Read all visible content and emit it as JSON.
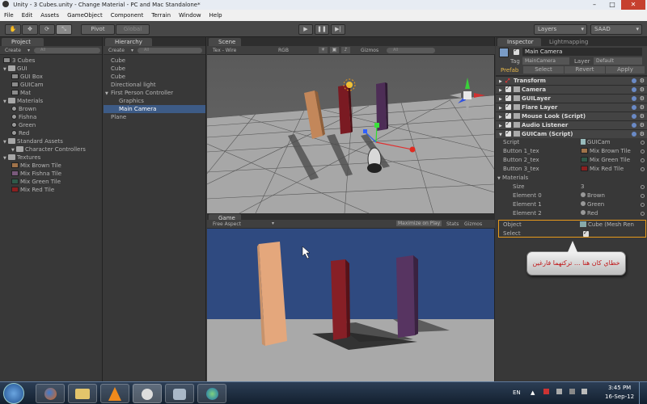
{
  "window": {
    "title": "Unity - 3 Cubes.unity - Change Material - PC and Mac Standalone*"
  },
  "menu": [
    "File",
    "Edit",
    "Assets",
    "GameObject",
    "Component",
    "Terrain",
    "Window",
    "Help"
  ],
  "toolbar": {
    "pivot": "Pivot",
    "global": "Global",
    "layers": "Layers",
    "layout": "SAAD"
  },
  "project": {
    "tab": "Project",
    "create": "Create",
    "items": [
      {
        "label": "3 Cubes",
        "indent": 0,
        "icon": "unity-scene-icon"
      },
      {
        "label": "GUI",
        "indent": 0,
        "icon": "folder-icon"
      },
      {
        "label": "GUI Box",
        "indent": 1,
        "icon": "file-icon"
      },
      {
        "label": "GUICam",
        "indent": 1,
        "icon": "script-icon"
      },
      {
        "label": "Mat",
        "indent": 1,
        "icon": "material-icon"
      },
      {
        "label": "Materials",
        "indent": 0,
        "icon": "folder-icon"
      },
      {
        "label": "Brown",
        "indent": 1,
        "icon": "sphere-icon"
      },
      {
        "label": "Fishna",
        "indent": 1,
        "icon": "sphere-icon"
      },
      {
        "label": "Green",
        "indent": 1,
        "icon": "sphere-icon"
      },
      {
        "label": "Red",
        "indent": 1,
        "icon": "sphere-icon"
      },
      {
        "label": "Standard Assets",
        "indent": 0,
        "icon": "folder-icon"
      },
      {
        "label": "Character Controllers",
        "indent": 1,
        "icon": "folder-icon"
      },
      {
        "label": "Textures",
        "indent": 0,
        "icon": "folder-icon"
      },
      {
        "label": "Mix Brown Tile",
        "indent": 1,
        "icon": "texture-icon",
        "color": "#a0734a"
      },
      {
        "label": "Mix Fishna Tile",
        "indent": 1,
        "icon": "texture-icon",
        "color": "#7a5a7c"
      },
      {
        "label": "Mix Green Tile",
        "indent": 1,
        "icon": "texture-icon",
        "color": "#2f5a4a"
      },
      {
        "label": "Mix Red Tile",
        "indent": 1,
        "icon": "texture-icon",
        "color": "#8a2020"
      }
    ]
  },
  "hierarchy": {
    "tab": "Hierarchy",
    "create": "Create",
    "items": [
      {
        "label": "Cube",
        "indent": 0
      },
      {
        "label": "Cube",
        "indent": 0
      },
      {
        "label": "Cube",
        "indent": 0
      },
      {
        "label": "Directional light",
        "indent": 0
      },
      {
        "label": "First Person Controller",
        "indent": 0
      },
      {
        "label": "Graphics",
        "indent": 1
      },
      {
        "label": "Main Camera",
        "indent": 1,
        "selected": true
      },
      {
        "label": "Plane",
        "indent": 0
      }
    ]
  },
  "scene": {
    "tab": "Scene",
    "shading": "Tex - Wire",
    "render": "RGB",
    "gizmos": "Gizmos"
  },
  "game": {
    "tab": "Game",
    "aspect": "Free Aspect",
    "maximize": "Maximize on Play",
    "stats": "Stats",
    "gizmos": "Gizmos"
  },
  "inspector": {
    "tab": "Inspector",
    "tab2": "Lightmapping",
    "object_name": "Main Camera",
    "tag_label": "Tag",
    "tag": "MainCamera",
    "layer_label": "Layer",
    "layer": "Default",
    "prefab": "Prefab",
    "select": "Select",
    "revert": "Revert",
    "apply": "Apply",
    "components": [
      "Transform",
      "Camera",
      "GUILayer",
      "Flare Layer",
      "Mouse Look (Script)",
      "Audio Listener",
      "GUICam (Script)"
    ],
    "fields": [
      {
        "label": "Script",
        "value": "GUICam",
        "indent": 0
      },
      {
        "label": "Button 1_tex",
        "value": "Mix Brown Tile",
        "indent": 0,
        "color": "#a0734a"
      },
      {
        "label": "Button 2_tex",
        "value": "Mix Green Tile",
        "indent": 0,
        "color": "#2f5a4a"
      },
      {
        "label": "Button 3_tex",
        "value": "Mix Red Tile",
        "indent": 0,
        "color": "#8a2020"
      },
      {
        "label": "Materials",
        "value": "",
        "indent": 0
      },
      {
        "label": "Size",
        "value": "3",
        "indent": 2
      },
      {
        "label": "Element 0",
        "value": "Brown",
        "indent": 2
      },
      {
        "label": "Element 1",
        "value": "Green",
        "indent": 2
      },
      {
        "label": "Element 2",
        "value": "Red",
        "indent": 2
      }
    ],
    "object_label": "Object",
    "object_value": "Cube (Mesh Ren",
    "select_label": "Select"
  },
  "annotation": {
    "text": "خطاي كان هنا ... تركتهما فارغين"
  },
  "taskbar": {
    "lang": "EN",
    "time": "3:45 PM",
    "date": "16-Sep-12"
  }
}
